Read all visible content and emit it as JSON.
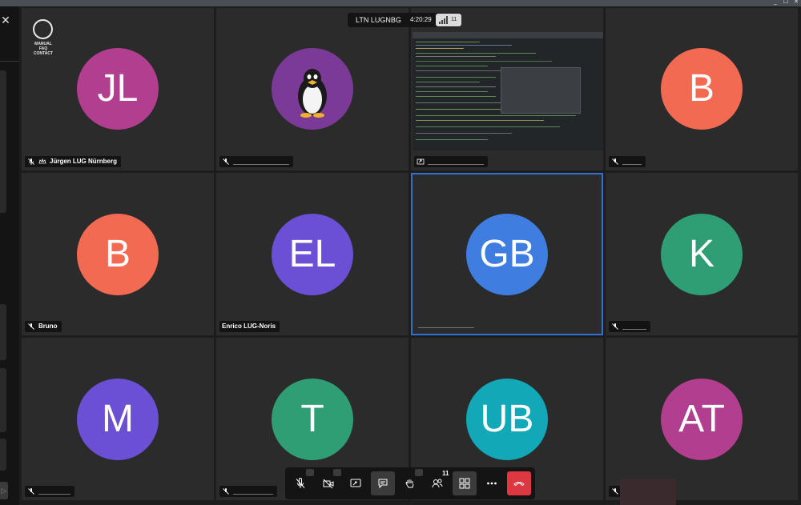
{
  "window": {
    "controls": [
      "_",
      "☐",
      "✕"
    ]
  },
  "sidebar": {
    "close_icon": "close-icon",
    "send_icon": "send-arrow-icon",
    "send_glyph": "▷"
  },
  "logo": {
    "lines": [
      "MANUAL",
      "FAQ",
      "CONTACT"
    ]
  },
  "meeting": {
    "name": "LTN LUGNBG",
    "time": "4:20:29",
    "participant_count": "11"
  },
  "tiles": [
    {
      "initials": "JL",
      "name": "Jürgen LUG Nürnberg",
      "color": "#b13e8e",
      "muted": true,
      "moderator": true
    },
    {
      "initials": "",
      "name": "",
      "color": "#7b3a97",
      "avatar_icon": "tux-penguin-icon",
      "muted": true
    },
    {
      "initials": "",
      "name": "",
      "screen_share": true,
      "muted": false
    },
    {
      "initials": "B",
      "name": "",
      "color": "#f26a52",
      "muted": true
    },
    {
      "initials": "B",
      "name": "Bruno",
      "color": "#f26a52",
      "muted": true
    },
    {
      "initials": "EL",
      "name": "Enrico LUG-Noris",
      "color": "#6b4fd4",
      "muted": false
    },
    {
      "initials": "GB",
      "name": "",
      "color": "#3f7ee0",
      "muted": false,
      "active_speaker": true
    },
    {
      "initials": "K",
      "name": "",
      "color": "#2f9e74",
      "muted": true
    },
    {
      "initials": "M",
      "name": "",
      "color": "#6b4fd4",
      "muted": true
    },
    {
      "initials": "T",
      "name": "",
      "color": "#2f9e74",
      "muted": true
    },
    {
      "initials": "UB",
      "name": "",
      "color": "#12a8b8",
      "muted": false
    },
    {
      "initials": "AT",
      "name": "",
      "color": "#b13e8e",
      "muted": true
    }
  ],
  "toolbar": {
    "buttons": [
      "microphone-icon",
      "camera-off-icon",
      "share-screen-icon",
      "chat-icon",
      "raise-hand-icon",
      "participants-icon",
      "tile-view-icon",
      "more-options-icon",
      "hang-up-icon"
    ],
    "participants_badge": "11"
  },
  "colors": {
    "background": "#1d1d1d",
    "tile": "#2b2b2b",
    "active_border": "#2d73d6",
    "hangup": "#dd3842"
  }
}
